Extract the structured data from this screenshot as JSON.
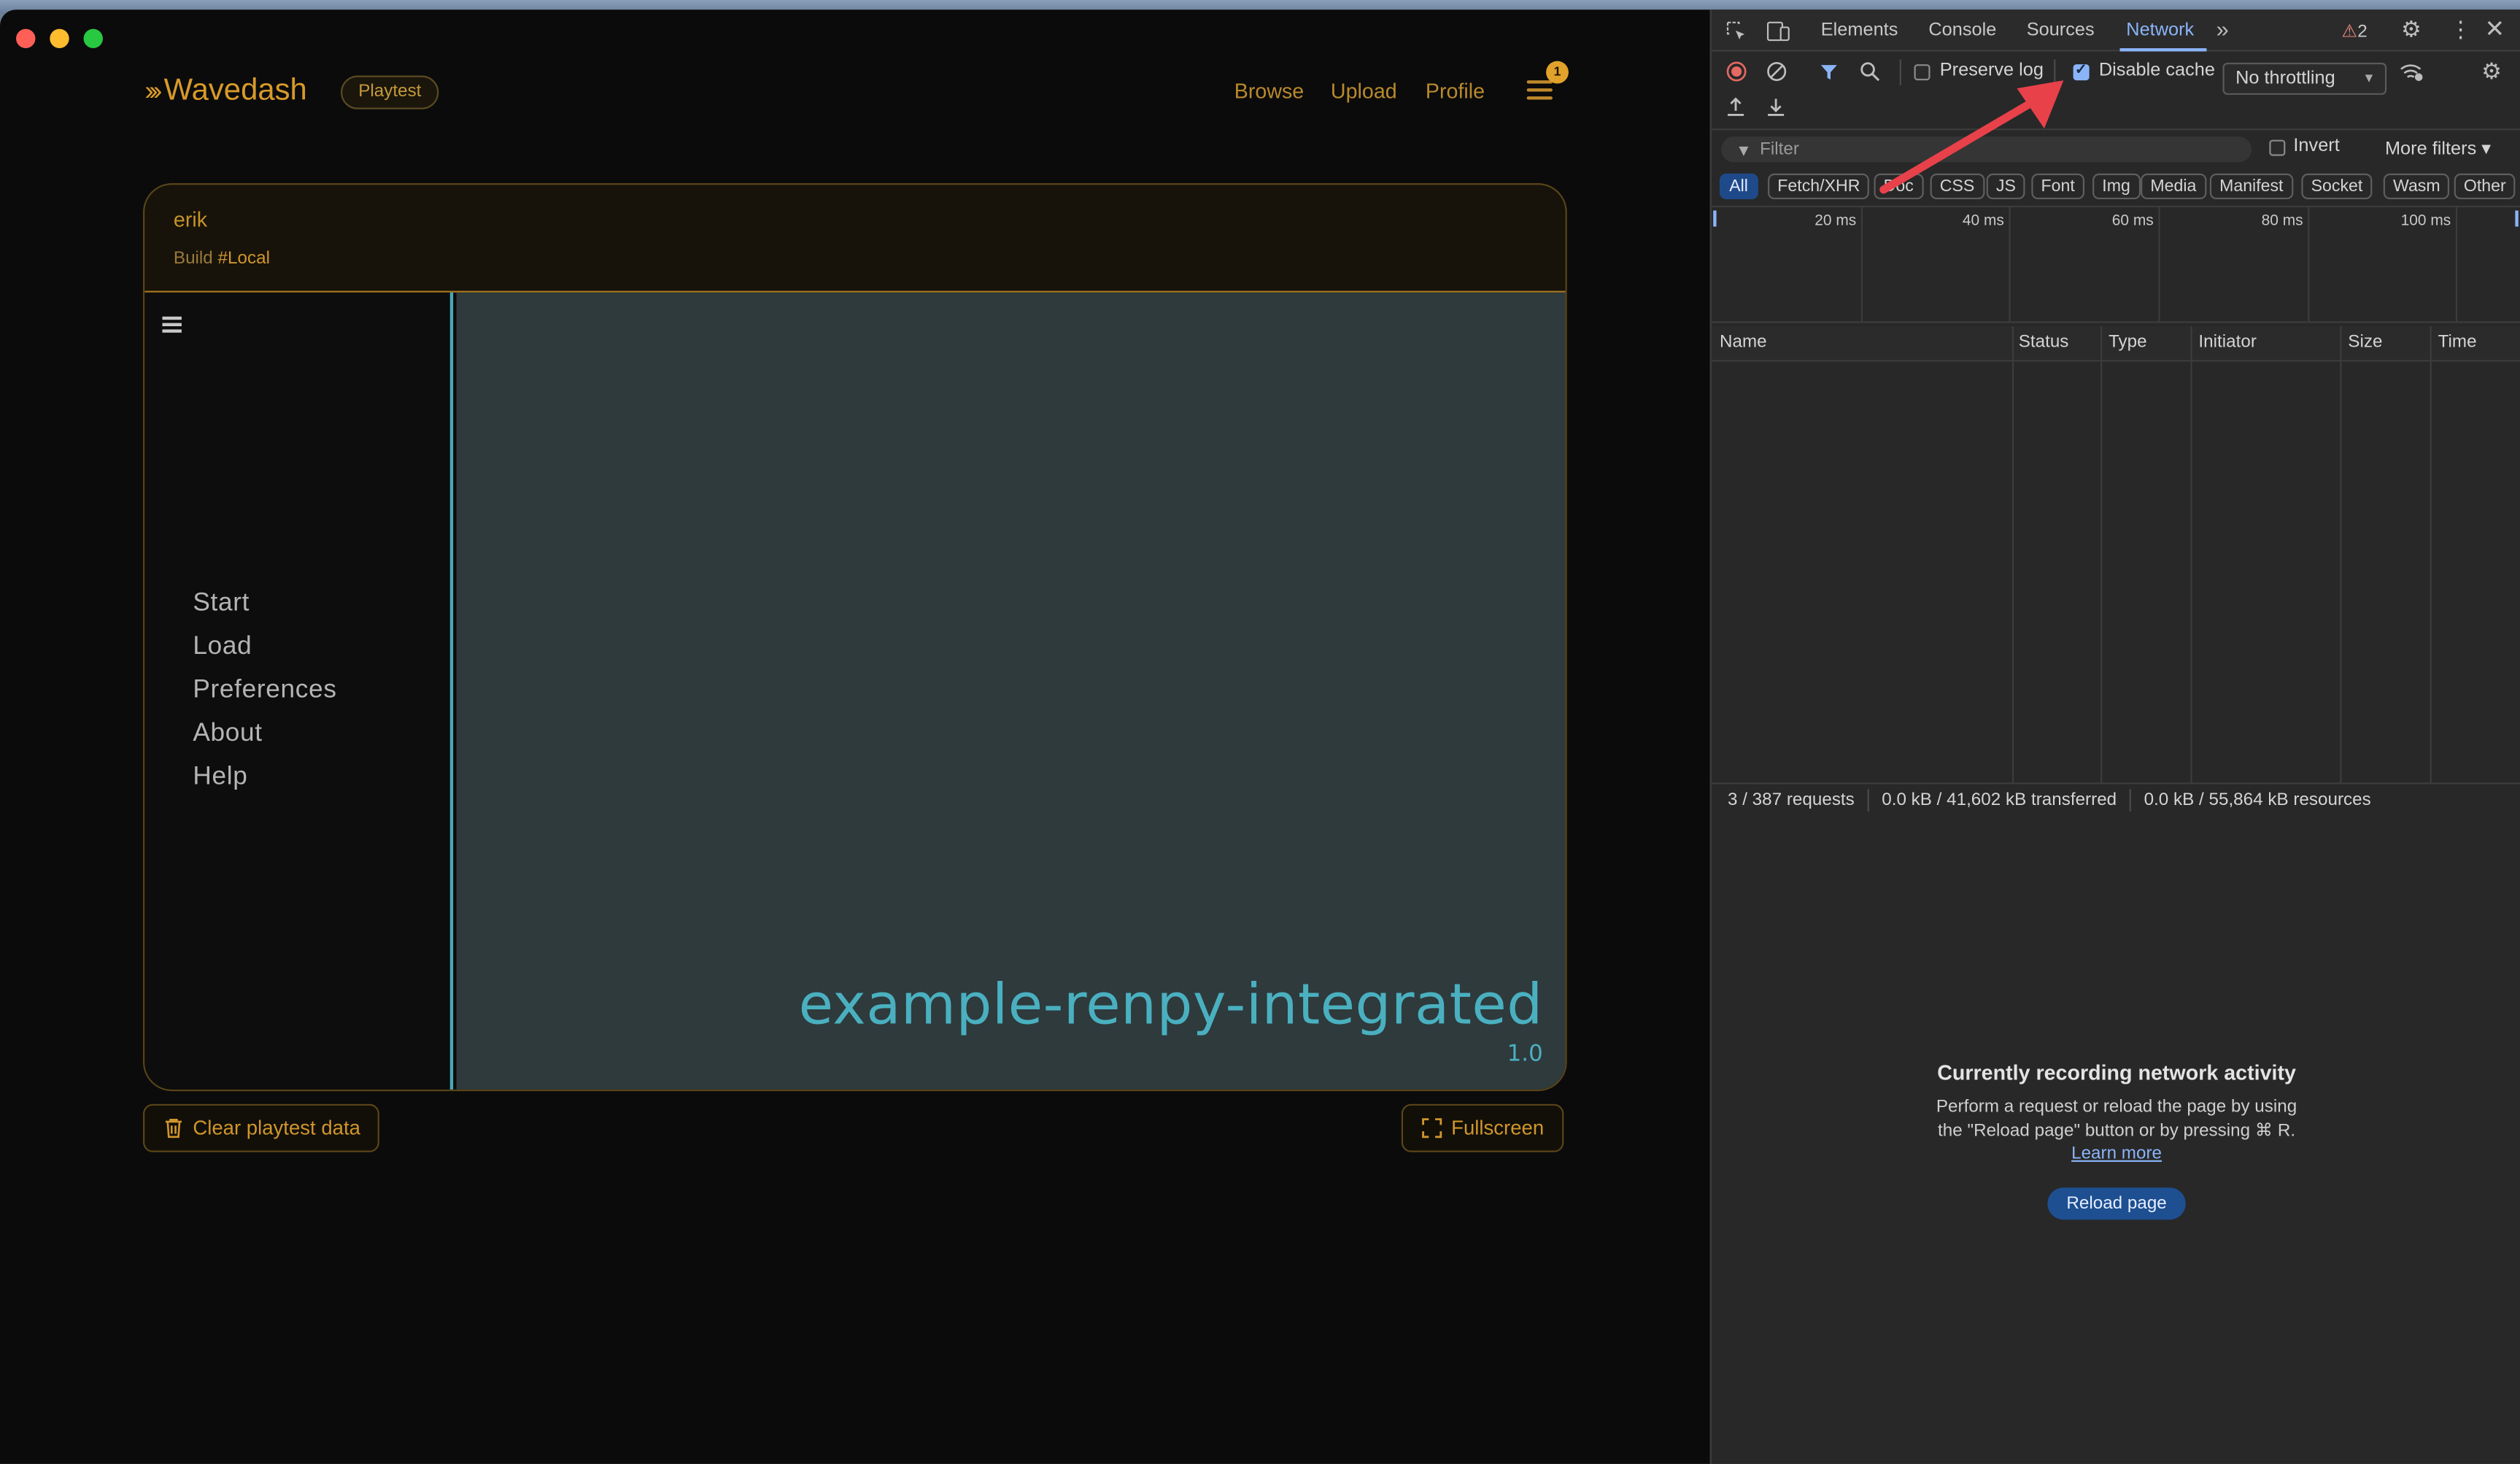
{
  "site": {
    "brand": "Wavedash",
    "badge": "Playtest",
    "nav": [
      "Browse",
      "Upload",
      "Profile"
    ],
    "notification_count": "1"
  },
  "playtest": {
    "user": "erik",
    "build_prefix": "Build",
    "build_tag": "#Local"
  },
  "game": {
    "menu_items": [
      "Start",
      "Load",
      "Preferences",
      "About",
      "Help"
    ],
    "title": "example-renpy-integrated",
    "version": "1.0"
  },
  "actions": {
    "clear": "Clear playtest data",
    "fullscreen": "Fullscreen"
  },
  "devtools": {
    "tabs": [
      "Elements",
      "Console",
      "Sources",
      "Network"
    ],
    "active_tab": "Network",
    "warning_count": "2",
    "preserve_log": "Preserve log",
    "disable_cache": "Disable cache",
    "disable_cache_checked": true,
    "throttling": "No throttling",
    "filter_placeholder": "Filter",
    "invert": "Invert",
    "more_filters": "More filters",
    "type_filters": [
      "All",
      "Fetch/XHR",
      "Doc",
      "CSS",
      "JS",
      "Font",
      "Img",
      "Media",
      "Manifest",
      "Socket",
      "Wasm",
      "Other"
    ],
    "timeline_ticks": [
      "20 ms",
      "40 ms",
      "60 ms",
      "80 ms",
      "100 ms"
    ],
    "columns": [
      "Name",
      "Status",
      "Type",
      "Initiator",
      "Size",
      "Time"
    ],
    "summary": {
      "requests": "3 / 387 requests",
      "transferred": "0.0 kB / 41,602 kB transferred",
      "resources": "0.0 kB / 55,864 kB resources"
    },
    "empty": {
      "title": "Currently recording network activity",
      "text": "Perform a request or reload the page by using the \"Reload page\" button or by pressing ⌘ R.",
      "link": "Learn more",
      "button": "Reload page"
    }
  },
  "colors": {
    "accent": "#d0962c",
    "game_text": "#4ab0c0",
    "devtools_active": "#8ab4f8",
    "annotation_arrow": "#e8414a"
  }
}
